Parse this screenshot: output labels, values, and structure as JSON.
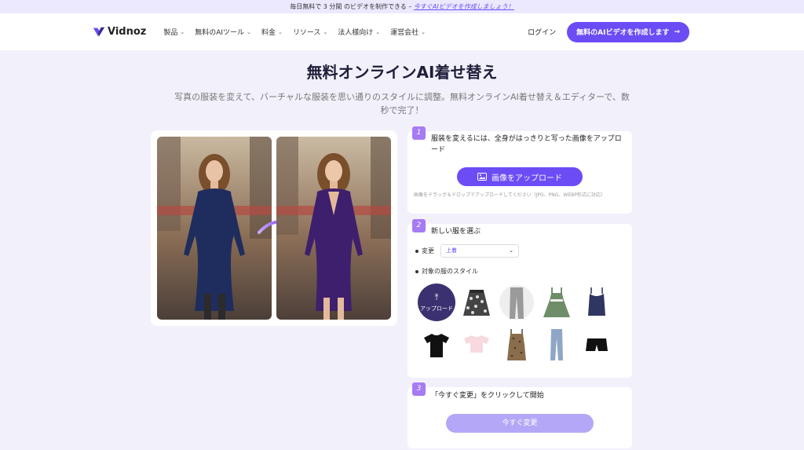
{
  "topbar": {
    "text": "毎日無料で 3 分間 のビデオを制作できる –",
    "link": "今すぐAIビデオを作成しましょう！"
  },
  "nav": {
    "logo": "Vidnoz",
    "items": [
      "製品",
      "無料のAIツール",
      "料金",
      "リソース",
      "法人様向け",
      "運営会社"
    ],
    "login": "ログイン",
    "cta": "無料のAIビデオを作成します",
    "colors": {
      "accent": "#6b4cf5"
    }
  },
  "hero": {
    "title": "無料オンラインAI着せ替え",
    "subtitle": "写真の服装を変えて、バーチャルな服装を思い通りのスタイルに調整。無料オンラインAI着せ替え＆エディターで、数秒で完了！"
  },
  "steps": {
    "one": {
      "number": "1",
      "title": "服装を変えるには、全身がはっきりと写った画像をアップロード",
      "button": "画像をアップロード",
      "hint": "画像をドラッグ＆ドロップでアップロードしてください（JPG、PNG、WEBP形式に対応）"
    },
    "two": {
      "number": "2",
      "title": "新しい服を選ぶ",
      "change_label": "変更",
      "select_value": "上着",
      "style_label": "対象の服のスタイル",
      "upload_label": "アップロード",
      "items": [
        "skirt-floral",
        "pants-grey",
        "dress-green",
        "tank-navy",
        "tshirt-black",
        "top-pink",
        "dress-leopard",
        "jeans-blue",
        "shorts-black"
      ]
    },
    "three": {
      "number": "3",
      "title": "「今すぐ変更」をクリックして開始",
      "button": "今すぐ変更"
    }
  }
}
